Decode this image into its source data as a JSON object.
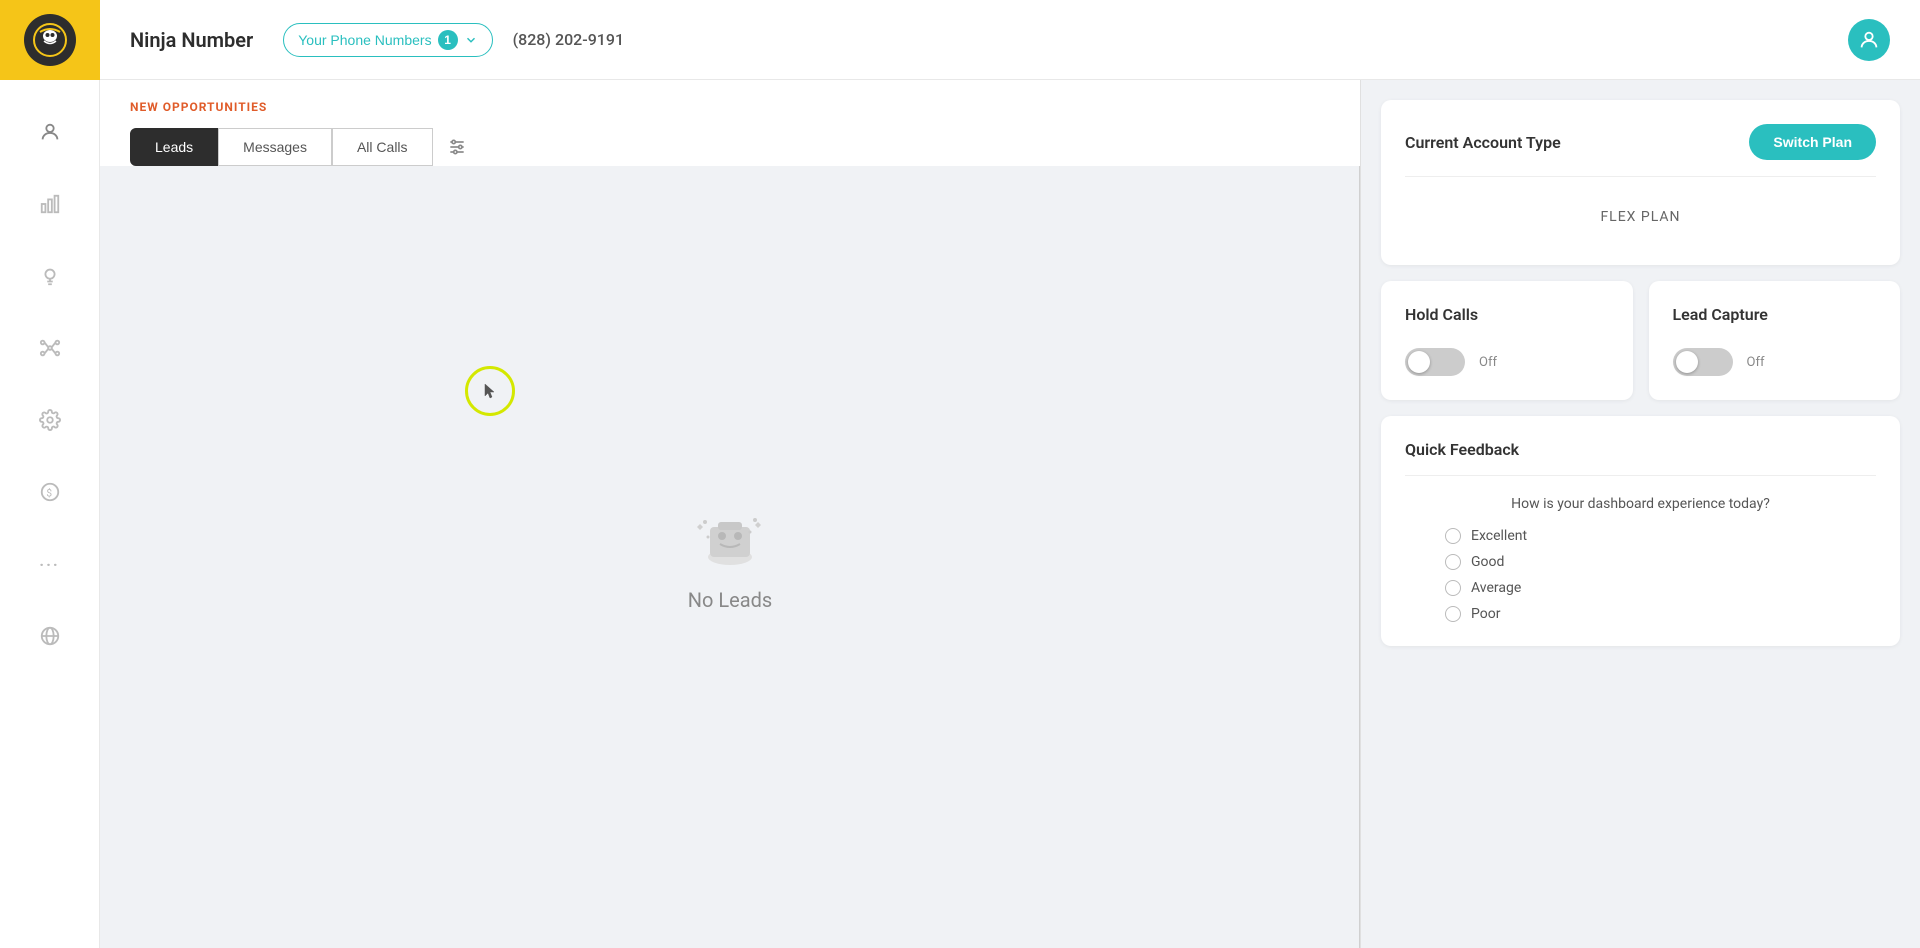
{
  "app": {
    "name": "Ninja Number",
    "phone_number": "(828) 202-9191"
  },
  "header": {
    "phone_numbers_label": "Your Phone Numbers",
    "phone_numbers_count": "1",
    "user_icon": "👤"
  },
  "sidebar": {
    "items": [
      {
        "id": "user",
        "icon": "👤"
      },
      {
        "id": "stats",
        "icon": "📊"
      },
      {
        "id": "ideas",
        "icon": "💡"
      },
      {
        "id": "integrations",
        "icon": "✦"
      },
      {
        "id": "settings",
        "icon": "⚙"
      },
      {
        "id": "billing",
        "icon": "💲"
      },
      {
        "id": "more",
        "icon": "···"
      },
      {
        "id": "globe",
        "icon": "🌐"
      }
    ]
  },
  "left_panel": {
    "section_label": "NEW OPPORTUNITIES",
    "tabs": [
      {
        "id": "leads",
        "label": "Leads",
        "active": true
      },
      {
        "id": "messages",
        "label": "Messages",
        "active": false
      },
      {
        "id": "all_calls",
        "label": "All Calls",
        "active": false
      }
    ],
    "no_leads_text": "No Leads"
  },
  "right_panel": {
    "account_card": {
      "title": "Current Account Type",
      "switch_plan_label": "Switch Plan",
      "plan_name": "FLEX PLAN"
    },
    "hold_calls_card": {
      "title": "Hold Calls",
      "toggle_label": "Off"
    },
    "lead_capture_card": {
      "title": "Lead Capture",
      "toggle_label": "Off"
    },
    "feedback_card": {
      "title": "Quick Feedback",
      "question": "How is your dashboard experience today?",
      "options": [
        {
          "id": "excellent",
          "label": "Excellent"
        },
        {
          "id": "good",
          "label": "Good"
        },
        {
          "id": "average",
          "label": "Average"
        },
        {
          "id": "poor",
          "label": "Poor"
        }
      ]
    }
  }
}
